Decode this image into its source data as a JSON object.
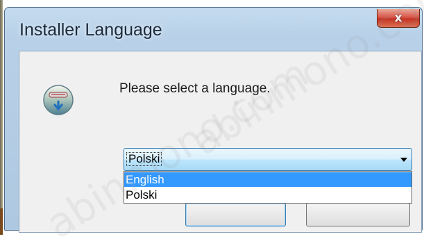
{
  "window": {
    "title": "Installer Language",
    "close_symbol": "x"
  },
  "dialog": {
    "icon": "installer-icon",
    "prompt": "Please select a language.",
    "language_select": {
      "value": "Polski",
      "options": [
        "English",
        "Polski"
      ],
      "highlighted_option": "English"
    }
  },
  "colors": {
    "title_bar": "#b9d1e8",
    "close_button": "#c33425",
    "dialog_background": "#f0f0f0",
    "highlight": "#3399ff"
  },
  "watermark": {
    "text_1": "abinmono.com",
    "text_2": "abinmono.com"
  }
}
